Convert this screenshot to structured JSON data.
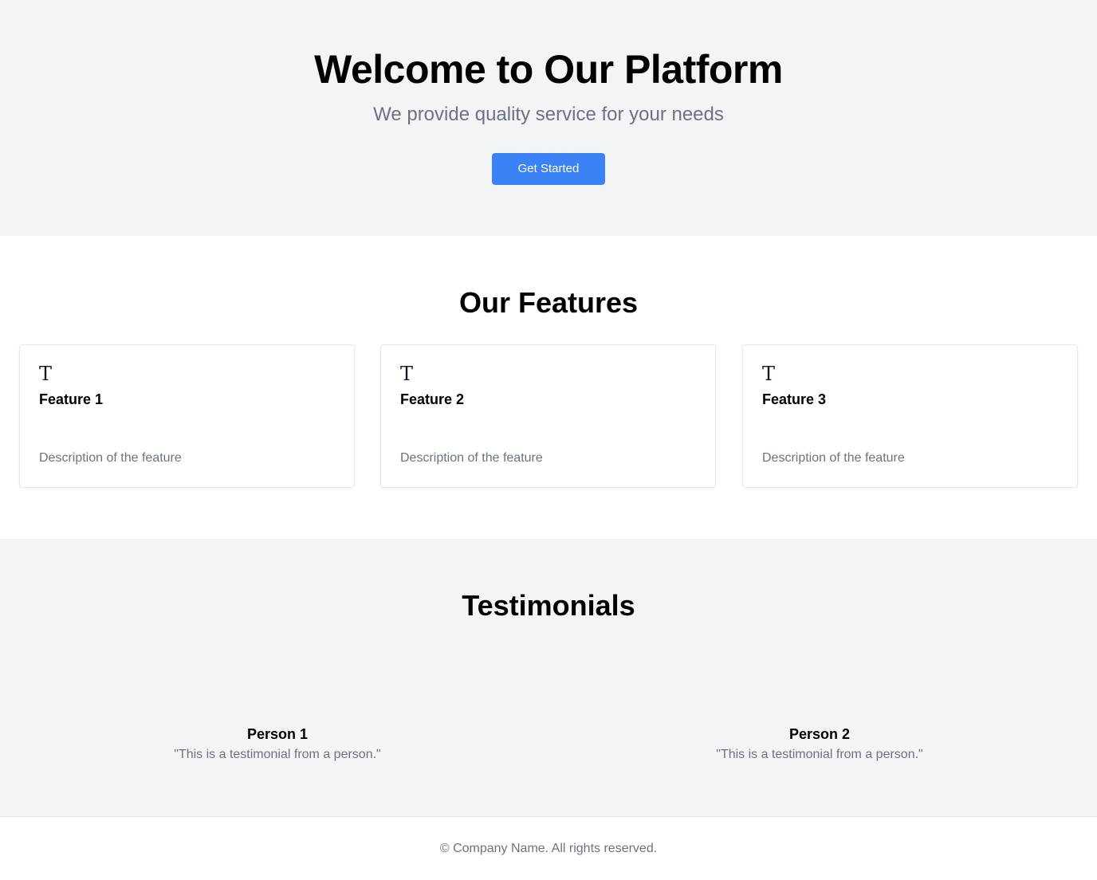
{
  "hero": {
    "title": "Welcome to Our Platform",
    "subtitle": "We provide quality service for your needs",
    "cta_label": "Get Started"
  },
  "features": {
    "title": "Our Features",
    "items": [
      {
        "icon": "T",
        "icon_name": "text-icon",
        "title": "Feature 1",
        "description": "Description of the feature"
      },
      {
        "icon": "T",
        "icon_name": "text-icon",
        "title": "Feature 2",
        "description": "Description of the feature"
      },
      {
        "icon": "T",
        "icon_name": "text-icon",
        "title": "Feature 3",
        "description": "Description of the feature"
      }
    ]
  },
  "testimonials": {
    "title": "Testimonials",
    "items": [
      {
        "name": "Person 1",
        "quote": "\"This is a testimonial from a person.\""
      },
      {
        "name": "Person 2",
        "quote": "\"This is a testimonial from a person.\""
      }
    ]
  },
  "footer": {
    "text": "© Company Name. All rights reserved."
  },
  "colors": {
    "accent": "#3b82f6",
    "section_bg": "#f3f4f6",
    "muted_text": "#6b7280"
  }
}
